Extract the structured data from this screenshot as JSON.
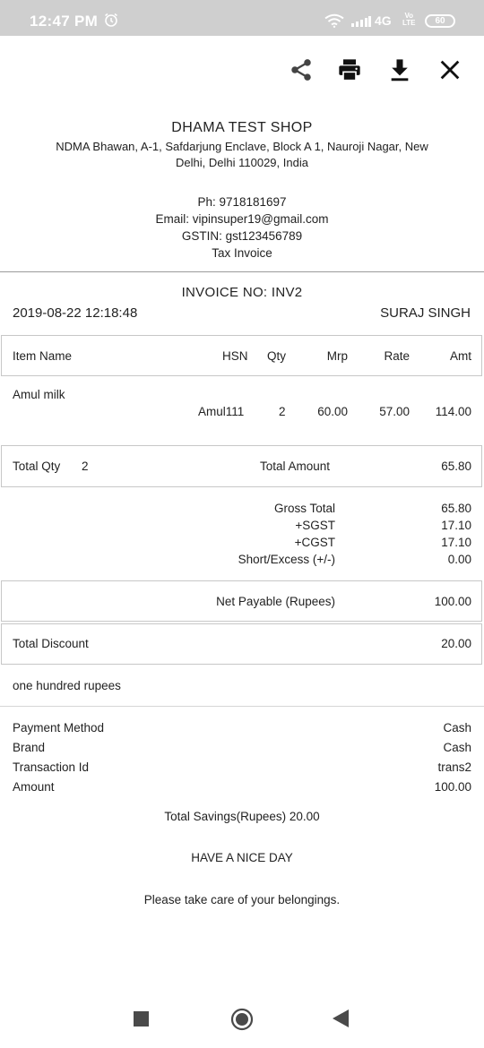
{
  "status_bar": {
    "time": "12:47 PM",
    "network": "4G",
    "volte": "Vo LTE",
    "battery": "60",
    "icons": [
      "alarm-icon",
      "wifi-icon",
      "signal-icon",
      "battery-icon"
    ]
  },
  "toolbar": {
    "icons": [
      "share-icon",
      "print-icon",
      "download-icon",
      "close-icon"
    ]
  },
  "shop": {
    "name": "DHAMA TEST SHOP",
    "address_line1": "NDMA Bhawan, A-1, Safdarjung Enclave, Block A 1, Nauroji Nagar, New",
    "address_line2": "Delhi, Delhi 110029, India",
    "phone": "Ph: 9718181697",
    "email": "Email: vipinsuper19@gmail.com",
    "gstin": "GSTIN: gst123456789",
    "doc_type": "Tax Invoice"
  },
  "invoice": {
    "number": "INVOICE NO: INV2",
    "datetime": "2019-08-22 12:18:48",
    "customer": "SURAJ SINGH"
  },
  "items_table": {
    "headers": {
      "item": "Item Name",
      "hsn": "HSN",
      "qty": "Qty",
      "mrp": "Mrp",
      "rate": "Rate",
      "amt": "Amt"
    },
    "rows": [
      {
        "item": "Amul milk",
        "hsn": "Amul111",
        "qty": "2",
        "mrp": "60.00",
        "rate": "57.00",
        "amt": "114.00"
      }
    ]
  },
  "totals": {
    "total_qty_label": "Total Qty",
    "total_qty": "2",
    "total_amount_label": "Total Amount",
    "total_amount": "65.80",
    "gross_total_label": "Gross Total",
    "gross_total": "65.80",
    "sgst_label": "+SGST",
    "sgst": "17.10",
    "cgst_label": "+CGST",
    "cgst": "17.10",
    "short_excess_label": "Short/Excess (+/-)",
    "short_excess": "0.00",
    "net_payable_label": "Net Payable (Rupees)",
    "net_payable": "100.00",
    "total_discount_label": "Total Discount",
    "total_discount": "20.00",
    "amount_words": "one hundred rupees"
  },
  "payment": {
    "method_label": "Payment Method",
    "method": "Cash",
    "brand_label": "Brand",
    "brand": "Cash",
    "txn_label": "Transaction Id",
    "txn": "trans2",
    "amount_label": "Amount",
    "amount": "100.00"
  },
  "footer": {
    "savings": "Total Savings(Rupees) 20.00",
    "greeting": "HAVE A NICE DAY",
    "note": "Please take care of your belongings."
  },
  "nav_bar": {
    "icons": [
      "recents-icon",
      "home-icon",
      "back-icon"
    ]
  }
}
